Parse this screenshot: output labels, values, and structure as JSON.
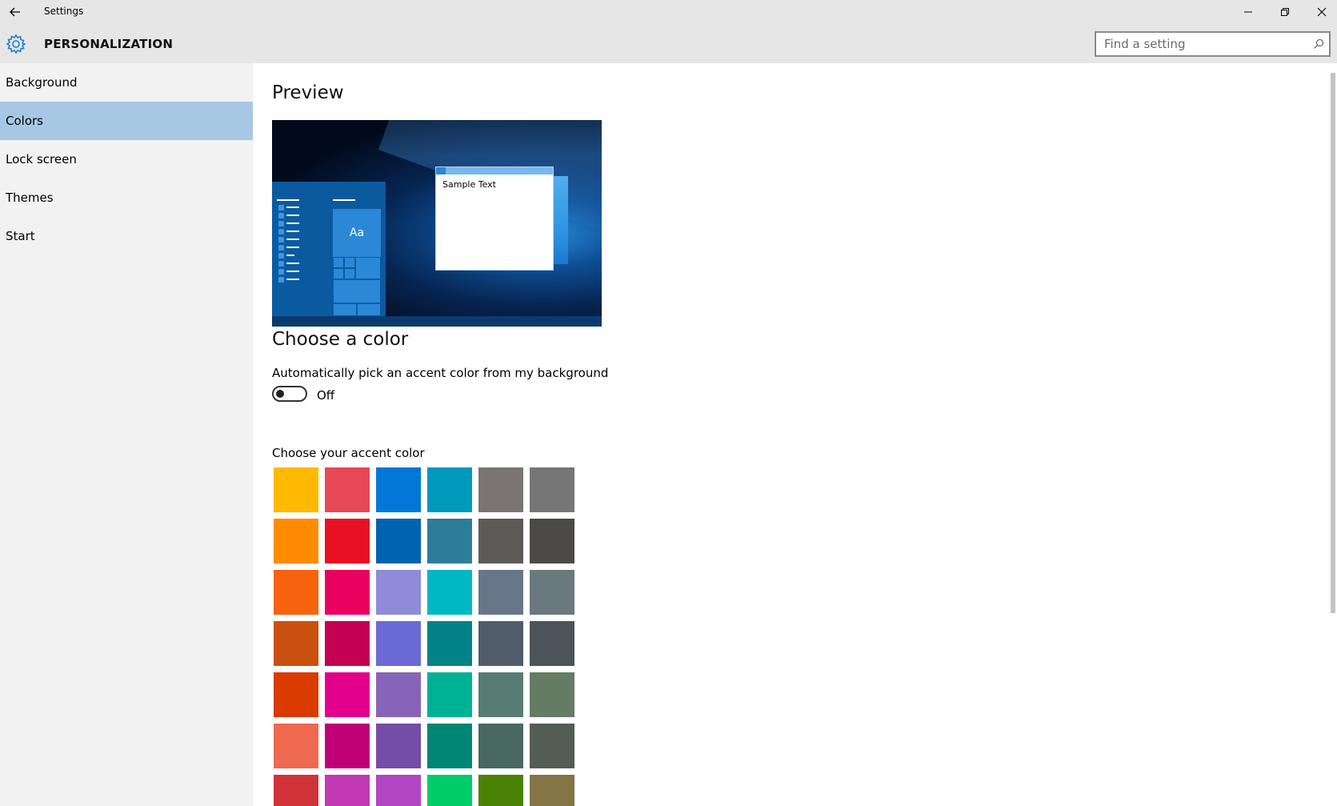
{
  "window": {
    "title": "Settings",
    "minimize_icon": "minimize-icon",
    "maximize_icon": "restore-icon",
    "close_icon": "close-icon"
  },
  "header": {
    "section_title": "PERSONALIZATION",
    "search_placeholder": "Find a setting"
  },
  "sidebar": {
    "items": [
      {
        "label": "Background",
        "selected": false
      },
      {
        "label": "Colors",
        "selected": true
      },
      {
        "label": "Lock screen",
        "selected": false
      },
      {
        "label": "Themes",
        "selected": false
      },
      {
        "label": "Start",
        "selected": false
      }
    ],
    "selected_color": "#a6c8e4"
  },
  "main": {
    "preview_heading": "Preview",
    "preview": {
      "start_tile_text": "Aa",
      "sample_text": "Sample Text"
    },
    "choose_heading": "Choose a color",
    "auto_accent_label": "Automatically pick an accent color from my background",
    "auto_accent_state": "Off",
    "accent_label": "Choose your accent color",
    "swatches": [
      "#FFB900",
      "#E74856",
      "#0078D7",
      "#0099BC",
      "#7A7574",
      "#767676",
      "#FF8C00",
      "#E81123",
      "#0063B1",
      "#2D7D9A",
      "#5D5A58",
      "#4C4A48",
      "#F7630C",
      "#EA005E",
      "#8E8CD8",
      "#00B7C3",
      "#68768A",
      "#69797E",
      "#CA5010",
      "#C30052",
      "#6B69D6",
      "#038387",
      "#515C6B",
      "#4A5459",
      "#DA3B01",
      "#E3008C",
      "#8764B8",
      "#00B294",
      "#567C73",
      "#647C64",
      "#EF6950",
      "#BF0077",
      "#744DA9",
      "#018574",
      "#486860",
      "#525E54",
      "#D13438",
      "#C239B3",
      "#B146C2",
      "#00CC6A",
      "#498205",
      "#847545"
    ]
  }
}
